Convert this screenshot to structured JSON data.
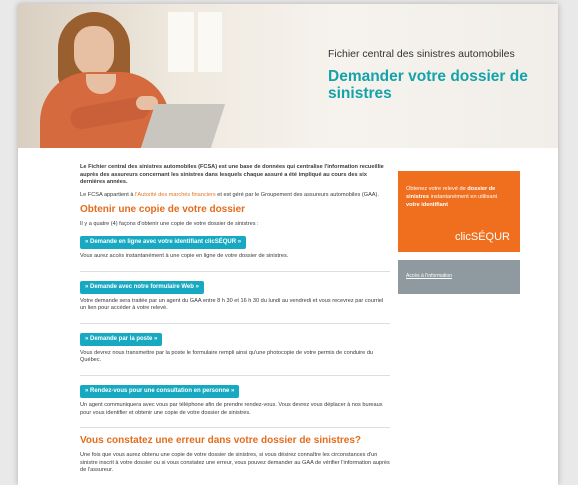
{
  "hero": {
    "kicker": "Fichier central des sinistres automobiles",
    "title": "Demander votre dossier de sinistres"
  },
  "intro": "Le Fichier central des sinistres automobiles (FCSA) est une base de données qui centralise l'information recueillie auprès des assureurs concernant les sinistres dans lesquels chaque assuré a été impliqué au cours des six dernières années.",
  "fcsa_text_before": "Le FCSA appartient à ",
  "fcsa_link": "l'Autorité des marchés financiers",
  "fcsa_text_after": " et est géré par le Groupement des assureurs automobiles (GAA).",
  "section1_title": "Obtenir une copie de votre dossier",
  "section1_lead": "Il y a quatre (4) façons d'obtenir une copie de votre dossier de sinistres :",
  "options": [
    {
      "button": "» Demande en ligne avec votre identifiant clicSÉQUR »",
      "text": "Vous aurez accès instantanément à une copie en ligne de votre dossier de sinistres."
    },
    {
      "button": "» Demande avec notre formulaire Web »",
      "text": "Votre demande sera traitée par un agent du GAA entre 8 h 30 et 16 h 30 du lundi au vendredi et vous recevrez par courriel un lien pour accéder à votre relevé."
    },
    {
      "button": "» Demande par la poste »",
      "text": "Vous devrez nous transmettre par la poste le formulaire rempli ainsi qu'une photocopie de votre permis de conduire du Québec."
    },
    {
      "button": "» Rendez-vous pour une consultation en personne »",
      "text": "Un agent communiquera avec vous par téléphone afin de prendre rendez-vous. Vous devrez vous déplacer à nos bureaux pour vous identifier et obtenir une copie de votre dossier de sinistres."
    }
  ],
  "section2_title": "Vous constatez une erreur dans votre dossier de sinistres?",
  "section2_text": "Une fois que vous aurez obtenu une copie de votre dossier de sinistres, si vous désirez connaître les circonstances d'un sinistre inscrit à votre dossier ou si vous constatez une erreur, vous pouvez demander au GAA de vérifier l'information auprès de l'assureur.",
  "sidebar": {
    "promo_before": "Obtenez votre relevé de ",
    "promo_bold1": "dossier de sinistres",
    "promo_mid": " instantanément en utilisant ",
    "promo_bold2": "votre identifiant",
    "logo": "clicSÉQUR",
    "gray_link": "Accès à l'information"
  },
  "colors": {
    "teal_title": "#13a3a8",
    "orange_heading": "#e36c1d",
    "button_blue": "#18a9c2",
    "sidebar_orange": "#f06f1f",
    "sidebar_gray": "#8e9aa0"
  }
}
